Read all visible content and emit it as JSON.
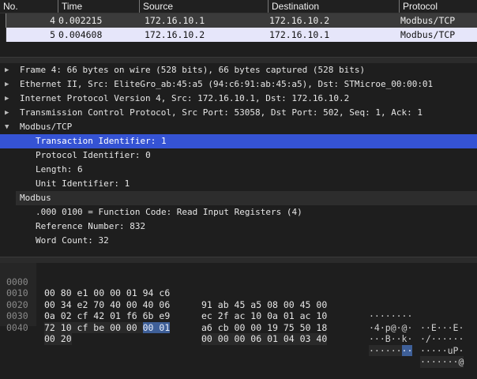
{
  "packet_list": {
    "columns": [
      "No.",
      "Time",
      "Source",
      "Destination",
      "Protocol"
    ],
    "rows": [
      {
        "no": "4",
        "time": "0.002215",
        "source": "172.16.10.1",
        "destination": "172.16.10.2",
        "protocol": "Modbus/TCP"
      },
      {
        "no": "5",
        "time": "0.004608",
        "source": "172.16.10.2",
        "destination": "172.16.10.1",
        "protocol": "Modbus/TCP"
      }
    ]
  },
  "details": {
    "frame": "Frame 4: 66 bytes on wire (528 bits), 66 bytes captured (528 bits)",
    "ethernet": "Ethernet II, Src: EliteGro_ab:45:a5 (94:c6:91:ab:45:a5), Dst: STMicroe_00:00:01",
    "ip": "Internet Protocol Version 4, Src: 172.16.10.1, Dst: 172.16.10.2",
    "tcp": "Transmission Control Protocol, Src Port: 53058, Dst Port: 502, Seq: 1, Ack: 1",
    "mbtcp": {
      "label": "Modbus/TCP",
      "fields": [
        "Transaction Identifier: 1",
        "Protocol Identifier: 0",
        "Length: 6",
        "Unit Identifier: 1"
      ]
    },
    "modbus": {
      "label": "Modbus",
      "fields": [
        ".000 0100 = Function Code: Read Input Registers (4)",
        "Reference Number: 832",
        "Word Count: 32"
      ]
    }
  },
  "hex": [
    {
      "off": "0000",
      "h1": "00 80 e1 00 00 01 94 c6",
      "h2": "91 ab 45 a5 08 00 45 00",
      "a1": "········",
      "a2": "··E···E·"
    },
    {
      "off": "0010",
      "h1": "00 34 e2 70 40 00 40 06",
      "h2": "ec 2f ac 10 0a 01 ac 10",
      "a1": "·4·p@·@·",
      "a2": "·/······"
    },
    {
      "off": "0020",
      "h1": "0a 02 cf 42 01 f6 6b e9",
      "h2": "a6 cb 00 00 19 75 50 18",
      "a1": "···B··k·",
      "a2": "·····uP·"
    },
    {
      "off": "0030",
      "h1a": "72 10 cf be 00 00 ",
      "h1b": "00 01",
      "h2": "00 00 00 06 01 04 03 40",
      "a1a": "r·····",
      "a1b": "··",
      "a2": "·······@"
    },
    {
      "off": "0040",
      "h1": "00 20",
      "a1": "·"
    }
  ],
  "colors": {
    "selected_row": "#3553d4",
    "selected_packet": "#e6e6fa",
    "byte_highlight": "#3e5f98"
  }
}
